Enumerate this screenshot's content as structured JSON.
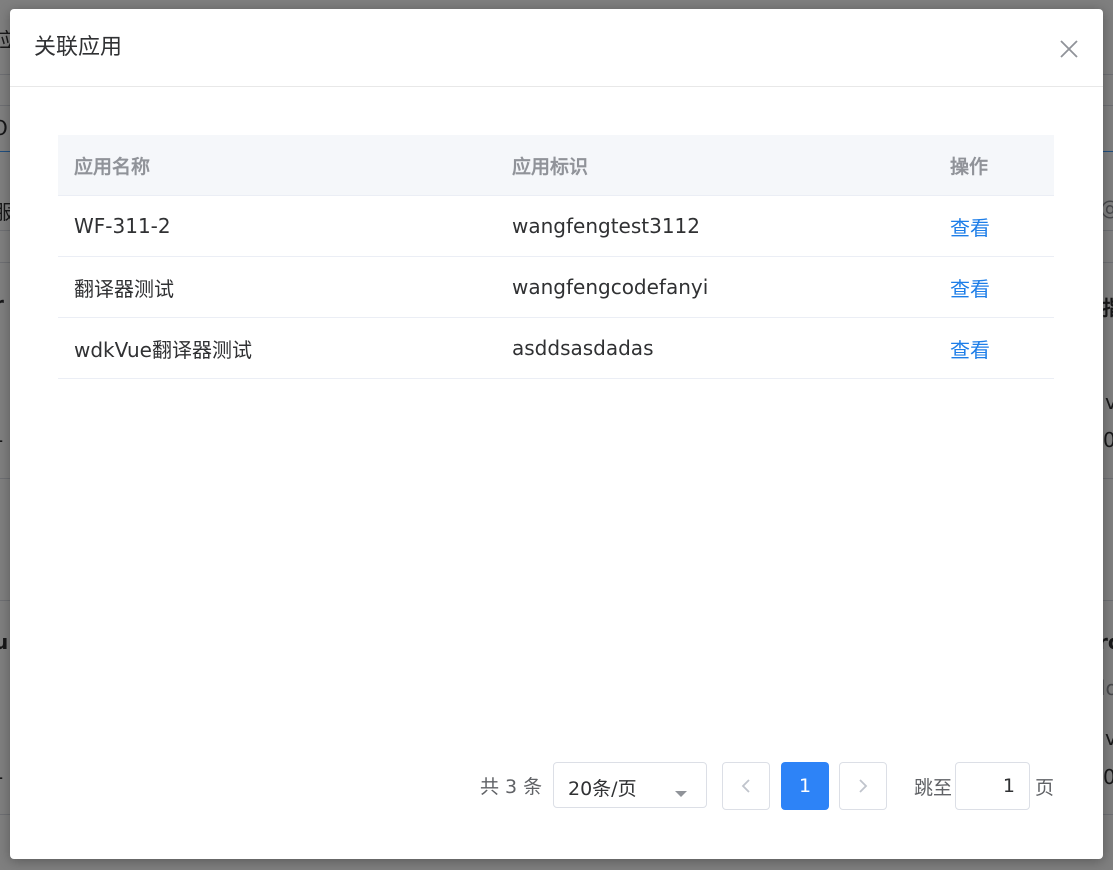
{
  "background": {
    "fragments": [
      "应",
      "O",
      "服",
      "r",
      "-",
      "u",
      "-",
      "指",
      "v",
      "0",
      "ro",
      "lo",
      "v",
      "0",
      "@"
    ]
  },
  "dialog": {
    "title": "关联应用",
    "close_icon": "close-icon",
    "table": {
      "columns": [
        "应用名称",
        "应用标识",
        "操作"
      ],
      "rows": [
        {
          "name": "WF-311-2",
          "id": "wangfengtest3112",
          "action": "查看"
        },
        {
          "name": "翻译器测试",
          "id": "wangfengcodefanyi",
          "action": "查看"
        },
        {
          "name": "wdkVue翻译器测试",
          "id": "asddsasdadas",
          "action": "查看"
        }
      ]
    },
    "pagination": {
      "total": "共 3 条",
      "page_size": "20条/页",
      "current_page": "1",
      "jump_label": "跳至",
      "jump_value": "1",
      "jump_suffix": "页"
    }
  },
  "colors": {
    "primary": "#2d83f7",
    "link": "#1e7ee8",
    "header_bg": "#f5f7fa"
  }
}
